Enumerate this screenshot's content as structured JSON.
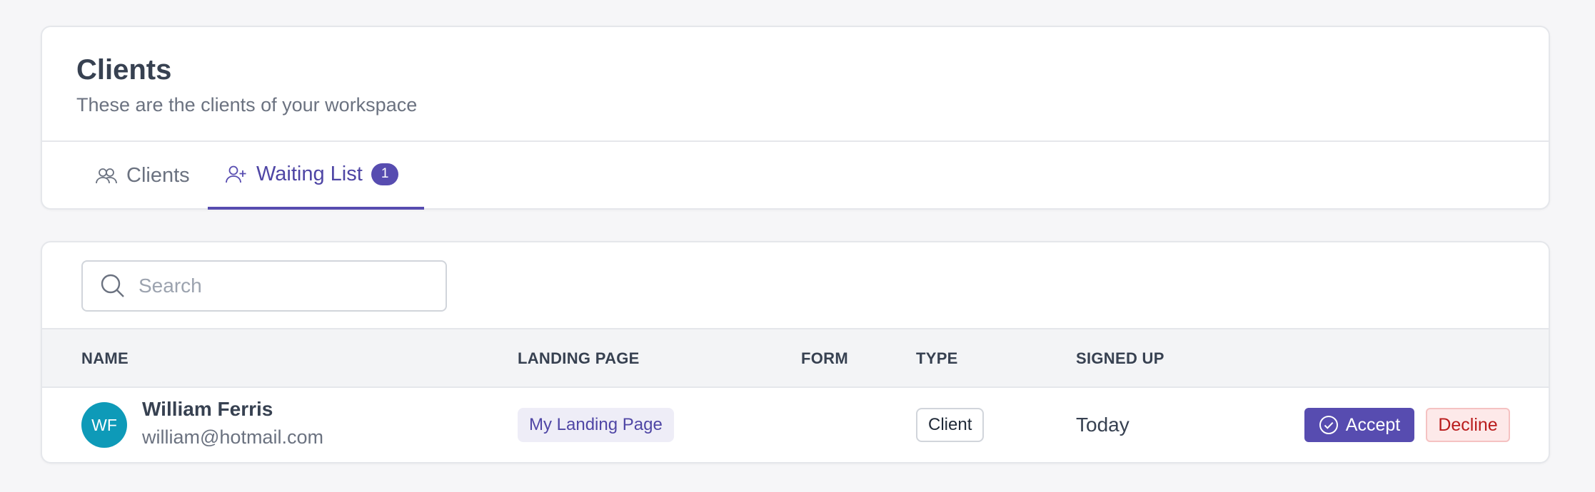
{
  "header": {
    "title": "Clients",
    "subtitle": "These are the clients of your workspace"
  },
  "tabs": [
    {
      "label": "Clients",
      "icon": "users-icon",
      "active": false
    },
    {
      "label": "Waiting List",
      "icon": "user-plus-icon",
      "active": true,
      "badge": "1"
    }
  ],
  "search": {
    "placeholder": "Search",
    "icon": "search-icon"
  },
  "table": {
    "columns": [
      "NAME",
      "LANDING PAGE",
      "FORM",
      "TYPE",
      "SIGNED UP"
    ],
    "rows": [
      {
        "initials": "WF",
        "name": "William Ferris",
        "email": "william@hotmail.com",
        "landing_page": "My Landing Page",
        "form": "",
        "type": "Client",
        "signed_up": "Today",
        "accept_label": "Accept",
        "decline_label": "Decline"
      }
    ]
  },
  "colors": {
    "accent": "#574cb0",
    "avatar": "#0e9ab8",
    "decline_text": "#b91c1c",
    "decline_bg": "#fde9e9"
  }
}
